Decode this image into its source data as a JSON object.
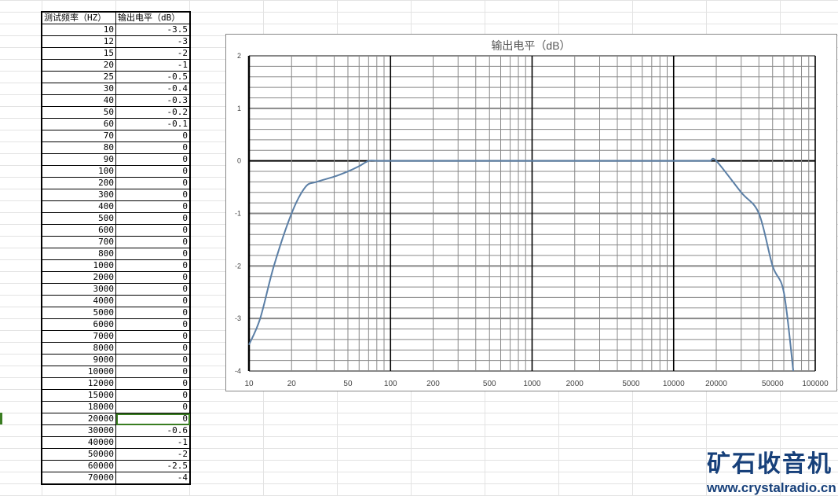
{
  "table": {
    "headers": [
      "测试频率（HZ）",
      "输出电平（dB）"
    ],
    "rows": [
      [
        "10",
        "-3.5"
      ],
      [
        "12",
        "-3"
      ],
      [
        "15",
        "-2"
      ],
      [
        "20",
        "-1"
      ],
      [
        "25",
        "-0.5"
      ],
      [
        "30",
        "-0.4"
      ],
      [
        "40",
        "-0.3"
      ],
      [
        "50",
        "-0.2"
      ],
      [
        "60",
        "-0.1"
      ],
      [
        "70",
        "0"
      ],
      [
        "80",
        "0"
      ],
      [
        "90",
        "0"
      ],
      [
        "100",
        "0"
      ],
      [
        "200",
        "0"
      ],
      [
        "300",
        "0"
      ],
      [
        "400",
        "0"
      ],
      [
        "500",
        "0"
      ],
      [
        "600",
        "0"
      ],
      [
        "700",
        "0"
      ],
      [
        "800",
        "0"
      ],
      [
        "1000",
        "0"
      ],
      [
        "2000",
        "0"
      ],
      [
        "3000",
        "0"
      ],
      [
        "4000",
        "0"
      ],
      [
        "5000",
        "0"
      ],
      [
        "6000",
        "0"
      ],
      [
        "7000",
        "0"
      ],
      [
        "8000",
        "0"
      ],
      [
        "9000",
        "0"
      ],
      [
        "10000",
        "0"
      ],
      [
        "12000",
        "0"
      ],
      [
        "15000",
        "0"
      ],
      [
        "18000",
        "0"
      ],
      [
        "20000",
        "0"
      ],
      [
        "30000",
        "-0.6"
      ],
      [
        "40000",
        "-1"
      ],
      [
        "50000",
        "-2"
      ],
      [
        "60000",
        "-2.5"
      ],
      [
        "70000",
        "-4"
      ]
    ],
    "selected_row": 33
  },
  "chart_data": {
    "type": "line",
    "title": "输出电平（dB）",
    "xscale": "log",
    "xlim": [
      10,
      100000
    ],
    "ylim": [
      -4,
      2
    ],
    "x": [
      10,
      12,
      15,
      20,
      25,
      30,
      40,
      50,
      60,
      70,
      80,
      90,
      100,
      200,
      300,
      400,
      500,
      600,
      700,
      800,
      1000,
      2000,
      3000,
      4000,
      5000,
      6000,
      7000,
      8000,
      9000,
      10000,
      12000,
      15000,
      18000,
      20000,
      30000,
      40000,
      50000,
      60000,
      70000
    ],
    "y": [
      -3.5,
      -3,
      -2,
      -1,
      -0.5,
      -0.4,
      -0.3,
      -0.2,
      -0.1,
      0,
      0,
      0,
      0,
      0,
      0,
      0,
      0,
      0,
      0,
      0,
      0,
      0,
      0,
      0,
      0,
      0,
      0,
      0,
      0,
      0,
      0,
      0,
      0,
      0,
      -0.6,
      -1,
      -2,
      -2.5,
      -4
    ],
    "xticks": [
      "10",
      "20",
      "50",
      "100",
      "200",
      "500",
      "1000",
      "2000",
      "5000",
      "10000",
      "20000",
      "50000",
      "100000"
    ],
    "yticks": [
      "2",
      "1",
      "0",
      "-1",
      "-2",
      "-3",
      "-4"
    ],
    "series_color": "#5b7fa6",
    "grid": true
  },
  "logo": {
    "name": "矿石收音机",
    "url": "www.crystalradio.cn"
  }
}
